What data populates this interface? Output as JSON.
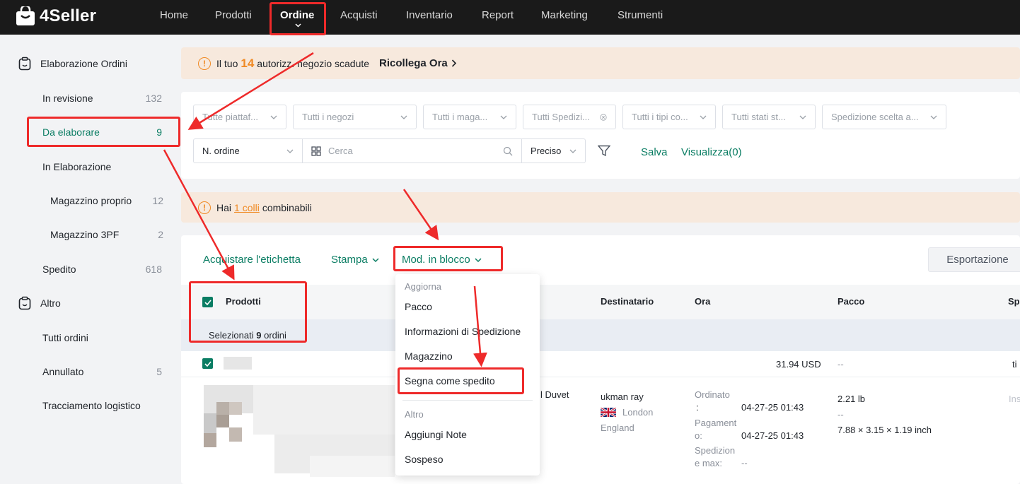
{
  "app": {
    "name": "4Seller"
  },
  "nav": [
    {
      "label": "Home"
    },
    {
      "label": "Prodotti"
    },
    {
      "label": "Ordine"
    },
    {
      "label": "Acquisti"
    },
    {
      "label": "Inventario"
    },
    {
      "label": "Report"
    },
    {
      "label": "Marketing"
    },
    {
      "label": "Strumenti"
    }
  ],
  "sidebar": {
    "group1": "Elaborazione Ordini",
    "items": [
      {
        "label": "In revisione",
        "count": "132"
      },
      {
        "label": "Da elaborare",
        "count": "9"
      },
      {
        "label": "In Elaborazione",
        "count": ""
      },
      {
        "label": "Magazzino proprio",
        "count": "12"
      },
      {
        "label": "Magazzino 3PF",
        "count": "2"
      },
      {
        "label": "Spedito",
        "count": "618"
      }
    ],
    "group2": "Altro",
    "items2": [
      {
        "label": "Tutti ordini",
        "count": ""
      },
      {
        "label": "Annullato",
        "count": "5"
      },
      {
        "label": "Tracciamento logistico",
        "count": ""
      }
    ]
  },
  "banner1": {
    "pre": "Il tuo",
    "num": "14",
    "post": "autorizz. negozio scadute",
    "link": "Ricollega Ora"
  },
  "filters": {
    "selects": [
      "Tutte piattaf...",
      "Tutti i negozi",
      "Tutti i maga...",
      "Tutti Spedizi...",
      "Tutti i tipi co...",
      "Tutti stati st...",
      "Spedizione scelta a..."
    ],
    "search_field": "N. ordine",
    "search_placeholder": "Cerca",
    "match": "Preciso",
    "save": "Salva",
    "view": "Visualizza(0)"
  },
  "banner2": {
    "pre": "Hai",
    "link": "1 colli",
    "post": "combinabili"
  },
  "toolbar": {
    "buy_label": "Acquistare l'etichetta",
    "print": "Stampa",
    "bulk": "Mod. in blocco",
    "export": "Esportazione"
  },
  "table": {
    "headers": [
      "Prodotti",
      "Destinatario",
      "Ora",
      "Pacco",
      "Sp"
    ],
    "selected_pre": "Selezionati",
    "selected_count": "9",
    "selected_post": "ordini",
    "order": {
      "amount": "31.94 USD",
      "pacco_dash": "--",
      "trail": "ti",
      "product_fragment": "l Duvet",
      "recipient_name": "ukman ray",
      "recipient_city": "London",
      "recipient_region": "England",
      "ordinato_label": "Ordinato",
      "ordinato_colon": ":",
      "ordinato_value": "04-27-25 01:43",
      "pagamento_label": "Pagament",
      "pagamento_label2": "o:",
      "pagamento_value": "04-27-25 01:43",
      "spedizione_label": "Spedizion",
      "spedizione_label2": "e max:",
      "spedizione_value": "--",
      "weight": "2.21 lb",
      "weight_dash": "--",
      "dims": "7.88 × 3.15 × 1.19 inch",
      "ins": "Ins"
    }
  },
  "dropdown": {
    "head1": "Aggiorna",
    "items1": [
      "Pacco",
      "Informazioni di Spedizione",
      "Magazzino",
      "Segna come spedito"
    ],
    "head2": "Altro",
    "items2": [
      "Aggiungi Note",
      "Sospeso"
    ]
  },
  "colors": {
    "accent": "#0a7d63",
    "warning": "#f08a24",
    "annotation": "#ee2a2a",
    "topbar": "#1a1a1a"
  }
}
